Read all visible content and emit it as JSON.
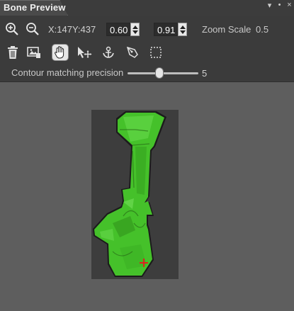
{
  "panel": {
    "title": "Bone Preview",
    "controls": [
      "dropdown-icon",
      "pin-icon",
      "close-icon"
    ]
  },
  "toolbar": {
    "zoom_in_icon": "zoom-in-icon",
    "zoom_out_icon": "zoom-out-icon",
    "coords": "X:147Y:437",
    "value_a": "0.60",
    "value_b": "0.91",
    "zoom_scale_label": "Zoom Scale",
    "zoom_scale_value": "0.5",
    "tools": [
      {
        "icon": "trash-icon",
        "active": false
      },
      {
        "icon": "image-icon",
        "active": false
      },
      {
        "icon": "hand-pan-icon",
        "active": true
      },
      {
        "icon": "move-arrow-icon",
        "active": false
      },
      {
        "icon": "bone-anchor-icon",
        "active": false
      },
      {
        "icon": "pen-icon",
        "active": false
      },
      {
        "icon": "select-rect-icon",
        "active": false
      }
    ],
    "precision_label": "Contour matching precision",
    "precision_value": "5",
    "precision_fraction": 0.45
  },
  "preview": {
    "accent": "#45c12a",
    "marker_color": "#e02020"
  }
}
